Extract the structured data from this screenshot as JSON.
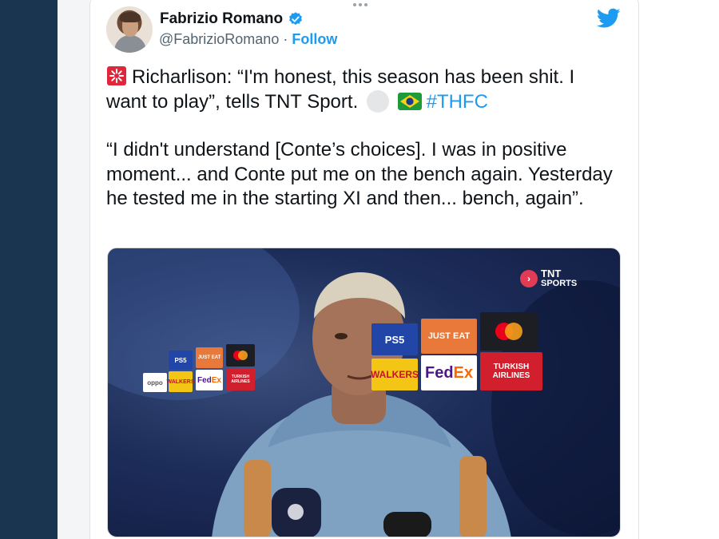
{
  "tweet": {
    "display_name": "Fabrizio Romano",
    "handle": "@FabrizioRomano",
    "separator": "·",
    "follow_label": "Follow",
    "line1_a": "Richarlison: “I'm honest, this season has been shit. I",
    "line1_b": "want to play”, tells TNT Sport.",
    "hashtag": "#THFC",
    "paragraph2": "“I didn't understand [Conte’s choices]. I was in positive moment... and Conte put me on the bench again. Yesterday he tested me in the starting XI and then... bench, again”.",
    "emojis": [
      "siren-icon",
      "white-circle",
      "brazil-flag"
    ]
  },
  "media": {
    "broadcaster_line1": "TNT",
    "broadcaster_line2": "SPORTS",
    "sponsors": {
      "ps5": "PS5",
      "just_eat": "JUST EAT",
      "walkers": "WALKERS",
      "fedex_fed": "Fed",
      "fedex_ex": "Ex",
      "turkish_1": "TURKISH",
      "turkish_2": "AIRLINES",
      "oppo": "oppo"
    }
  },
  "colors": {
    "sidebar": "#1a3550",
    "link": "#1d9bf0",
    "text": "#0f1419",
    "muted": "#536471",
    "tnt_red": "#e23b55"
  }
}
